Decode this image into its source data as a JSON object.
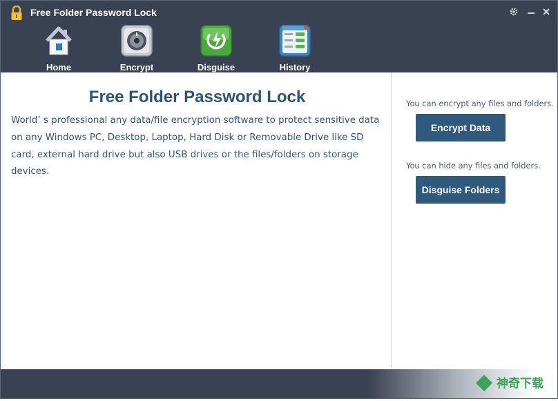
{
  "window": {
    "title": "Free Folder Password Lock",
    "controls": [
      "gear-icon",
      "minimize-icon",
      "close-icon"
    ]
  },
  "toolbar": {
    "items": [
      {
        "label": "Home",
        "icon": "home-icon"
      },
      {
        "label": "Encrypt",
        "icon": "safe-dial-icon"
      },
      {
        "label": "Disguise",
        "icon": "disguise-shield-icon"
      },
      {
        "label": "History",
        "icon": "history-list-icon"
      }
    ]
  },
  "main": {
    "heading": "Free Folder Password Lock",
    "description": "World’ s professional any data/file encryption software to protect sensitive data on any Windows PC, Desktop, Laptop, Hard Disk or Removable Drive like SD card, external hard drive but also USB drives or the files/folders on storage devices."
  },
  "side": {
    "encrypt_hint": "You can encrypt any files and folders.",
    "encrypt_button": "Encrypt Data",
    "hide_hint": "You can hide any files and folders.",
    "disguise_button": "Disguise Folders"
  },
  "watermark": {
    "text": "神奇下载"
  },
  "colors": {
    "titlebar": "#394253",
    "accent": "#2f5a7e",
    "heading": "#2b5576",
    "watermark_green": "#3aa35a"
  }
}
